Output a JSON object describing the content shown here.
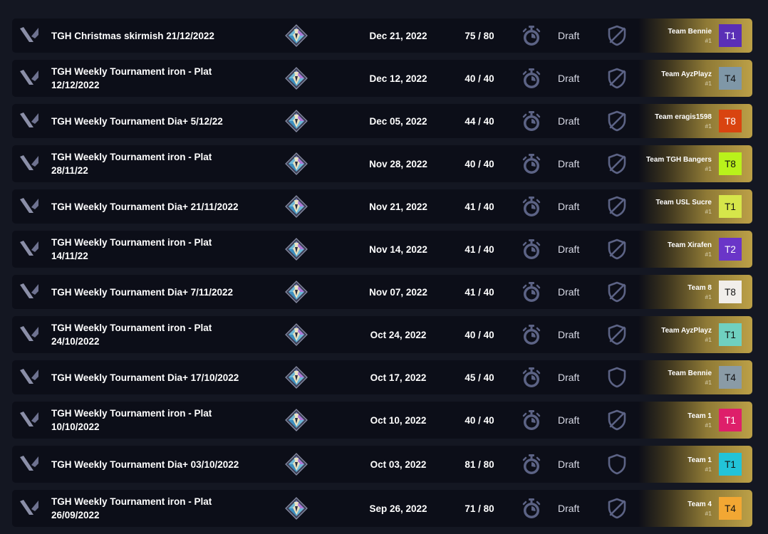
{
  "tournaments": [
    {
      "name": "TGH Christmas skirmish 21/12/2022",
      "date": "Dec 21, 2022",
      "count": "75 / 80",
      "status": "Draft",
      "shield": "checked",
      "team": "Team Bennie",
      "pos": "#1",
      "badge": "T1",
      "badge_bg": "#5a2fb6",
      "badge_fg": "#ffffff"
    },
    {
      "name": "TGH Weekly Tournament iron - Plat 12/12/2022",
      "date": "Dec 12, 2022",
      "count": "40 / 40",
      "status": "Draft",
      "shield": "checked",
      "team": "Team AyzPlayz",
      "pos": "#1",
      "badge": "T4",
      "badge_bg": "#7f97a7",
      "badge_fg": "#111111"
    },
    {
      "name": "TGH Weekly Tournament Dia+ 5/12/22",
      "date": "Dec 05, 2022",
      "count": "44 / 40",
      "status": "Draft",
      "shield": "checked",
      "team": "Team eragis1598",
      "pos": "#1",
      "badge": "T8",
      "badge_bg": "#d94410",
      "badge_fg": "#ffffff"
    },
    {
      "name": "TGH Weekly Tournament iron - Plat 28/11/22",
      "date": "Nov 28, 2022",
      "count": "40 / 40",
      "status": "Draft",
      "shield": "checked",
      "team": "Team TGH Bangers",
      "pos": "#1",
      "badge": "T8",
      "badge_bg": "#b9f21b",
      "badge_fg": "#111111"
    },
    {
      "name": "TGH Weekly Tournament Dia+ 21/11/2022",
      "date": "Nov 21, 2022",
      "count": "41 / 40",
      "status": "Draft",
      "shield": "checked",
      "team": "Team USL Sucre",
      "pos": "#1",
      "badge": "T1",
      "badge_bg": "#d6e64a",
      "badge_fg": "#111111"
    },
    {
      "name": "TGH Weekly Tournament iron - Plat 14/11/22",
      "date": "Nov 14, 2022",
      "count": "41 / 40",
      "status": "Draft",
      "shield": "checked",
      "team": "Team Xirafen",
      "pos": "#1",
      "badge": "T2",
      "badge_bg": "#6a35c8",
      "badge_fg": "#ffffff"
    },
    {
      "name": "TGH Weekly Tournament Dia+ 7/11/2022",
      "date": "Nov 07, 2022",
      "count": "41 / 40",
      "status": "Draft",
      "shield": "checked",
      "team": "Team 8",
      "pos": "#1",
      "badge": "T8",
      "badge_bg": "#f1eeea",
      "badge_fg": "#111111"
    },
    {
      "name": "TGH Weekly Tournament iron - Plat 24/10/2022",
      "date": "Oct 24, 2022",
      "count": "40 / 40",
      "status": "Draft",
      "shield": "checked",
      "team": "Team AyzPlayz",
      "pos": "#1",
      "badge": "T1",
      "badge_bg": "#6fd0c0",
      "badge_fg": "#111111"
    },
    {
      "name": "TGH Weekly Tournament Dia+ 17/10/2022",
      "date": "Oct 17, 2022",
      "count": "45 / 40",
      "status": "Draft",
      "shield": "plain",
      "team": "Team Bennie",
      "pos": "#1",
      "badge": "T4",
      "badge_bg": "#8a9ba6",
      "badge_fg": "#111111"
    },
    {
      "name": "TGH Weekly Tournament iron - Plat 10/10/2022",
      "date": "Oct 10, 2022",
      "count": "40 / 40",
      "status": "Draft",
      "shield": "checked",
      "team": "Team 1",
      "pos": "#1",
      "badge": "T1",
      "badge_bg": "#de1f6a",
      "badge_fg": "#ffffff"
    },
    {
      "name": "TGH Weekly Tournament Dia+ 03/10/2022",
      "date": "Oct 03, 2022",
      "count": "81 / 80",
      "status": "Draft",
      "shield": "plain",
      "team": "Team 1",
      "pos": "#1",
      "badge": "T1",
      "badge_bg": "#22c3d8",
      "badge_fg": "#111111"
    },
    {
      "name": "TGH Weekly Tournament iron - Plat 26/09/2022",
      "date": "Sep 26, 2022",
      "count": "71 / 80",
      "status": "Draft",
      "shield": "checked",
      "team": "Team 4",
      "pos": "#1",
      "badge": "T4",
      "badge_bg": "#f2a733",
      "badge_fg": "#111111"
    }
  ]
}
